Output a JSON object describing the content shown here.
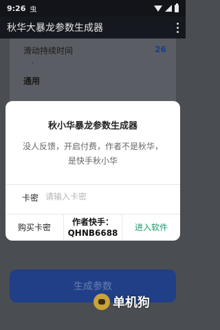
{
  "status_bar": {
    "time": "9:26",
    "notification": "虫"
  },
  "app_bar": {
    "title": "秋华大暴龙参数生成器"
  },
  "settings": {
    "scroll_duration_label": "滑动持续时间",
    "scroll_duration_value": "26",
    "dot": ".",
    "general_label": "通用"
  },
  "generate_button": "生成参数",
  "dialog": {
    "title": "秋小华暴龙参数生成器",
    "message": "没人反馈，开启付费，作者不是秋华，是快手秋小华",
    "key_label": "卡密",
    "key_placeholder": "请输入卡密",
    "key_value": "",
    "buy_label": "购买卡密",
    "author_label": "作者快手：",
    "author_id": "QHNB6688",
    "enter_label": "进入软件"
  },
  "watermark": {
    "text": "单机狗"
  }
}
